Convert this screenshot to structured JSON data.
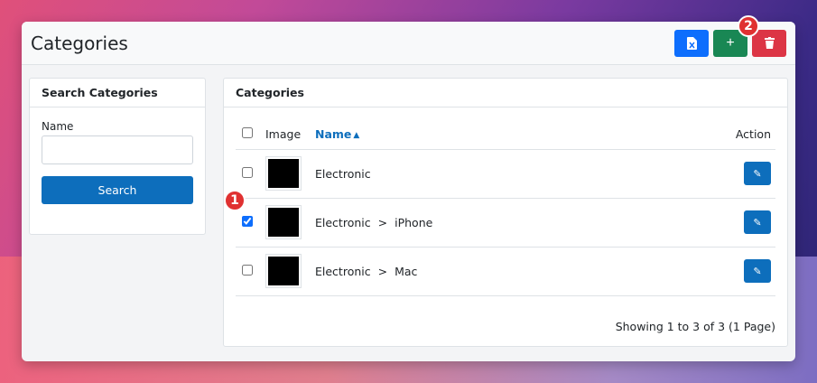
{
  "header": {
    "title": "Categories",
    "actions": [
      {
        "name": "export-button",
        "icon": "file-excel-icon",
        "glyph": "▣",
        "color": "#0d6efd"
      },
      {
        "name": "add-button",
        "icon": "plus-icon",
        "glyph": "+",
        "color": "#198754"
      },
      {
        "name": "delete-button",
        "icon": "trash-icon",
        "glyph": "🗑",
        "color": "#dc3545"
      }
    ]
  },
  "search": {
    "heading": "Search Categories",
    "name_label": "Name",
    "name_value": "",
    "button_label": "Search"
  },
  "list": {
    "heading": "Categories",
    "columns": {
      "image": "Image",
      "name": "Name",
      "action": "Action"
    },
    "sort": {
      "column": "Name",
      "direction": "ascending"
    },
    "rows": [
      {
        "name": "Electronic",
        "parent": "",
        "checked": false,
        "image_icon": "apple-logo-icon"
      },
      {
        "name": "iPhone",
        "parent": "Electronic",
        "checked": true,
        "image_icon": "apple-logo-icon"
      },
      {
        "name": "Mac",
        "parent": "Electronic",
        "checked": false,
        "image_icon": "apple-logo-icon"
      }
    ],
    "separator": ">",
    "footer": "Showing 1 to 3 of 3 (1 Page)"
  },
  "annotations": [
    "1",
    "2"
  ],
  "colors": {
    "primary": "#0d6ebc",
    "success": "#198754",
    "danger": "#dc3545",
    "badge": "#e03131"
  }
}
